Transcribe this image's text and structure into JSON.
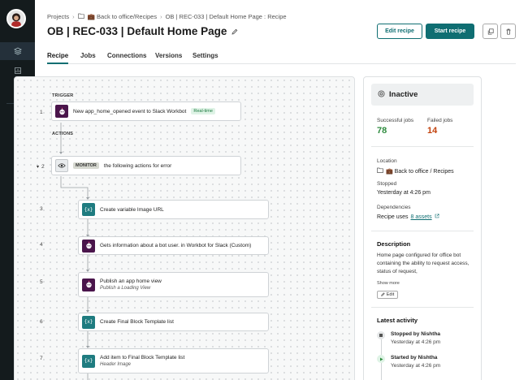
{
  "breadcrumb": {
    "projects": "Projects",
    "folder": "💼 Back to office/Recipes",
    "current": "OB | REC-033 | Default Home Page : Recipe"
  },
  "page": {
    "title": "OB | REC-033 | Default Home Page"
  },
  "actions": {
    "edit_label": "Edit recipe",
    "start_label": "Start recipe"
  },
  "tabs": [
    "Recipe",
    "Jobs",
    "Connections",
    "Versions",
    "Settings"
  ],
  "flow": {
    "trigger_label": "TRIGGER",
    "actions_label": "ACTIONS",
    "steps": [
      {
        "num": "1",
        "text": "New app_home_opened event to Slack Workbot",
        "tag": "Real-time"
      },
      {
        "num": "2",
        "tag": "MONITOR",
        "text": "the following actions for error"
      },
      {
        "num": "3",
        "text": "Create variable Image URL"
      },
      {
        "num": "4",
        "text": "Gets information about a bot user. in Workbot for Slack (Custom)"
      },
      {
        "num": "5",
        "text": "Publish an app home view",
        "sub": "Publish a Loading View"
      },
      {
        "num": "6",
        "text": "Create Final Block Template list"
      },
      {
        "num": "7",
        "text": "Add item to Final Block Template list",
        "sub": "Header Image"
      }
    ]
  },
  "status_panel": {
    "status": "Inactive",
    "successful_label": "Successful jobs",
    "successful_value": "78",
    "failed_label": "Failed jobs",
    "failed_value": "14",
    "location_label": "Location",
    "location_value": "💼 Back to office / Recipes",
    "stopped_label": "Stopped",
    "stopped_value": "Yesterday at 4:26 pm",
    "dependencies_label": "Dependencies",
    "dependencies_prefix": "Recipe uses",
    "dependencies_link": "8 assets",
    "description_label": "Description",
    "description_text": "Home page configured for office bot containing the ability to request access, status of request,",
    "show_more": "Show more",
    "edit_label": "Edit",
    "latest_activity_label": "Latest activity",
    "activity": [
      {
        "title": "Stopped by Nishtha",
        "time": "Yesterday at 4:26 pm"
      },
      {
        "title": "Started by Nishtha",
        "time": "Yesterday at 4:26 pm"
      }
    ]
  },
  "colors": {
    "accent": "#0f6e72",
    "success": "#2e8b3e",
    "failure": "#c2410c",
    "sidebar": "#141b1d"
  }
}
